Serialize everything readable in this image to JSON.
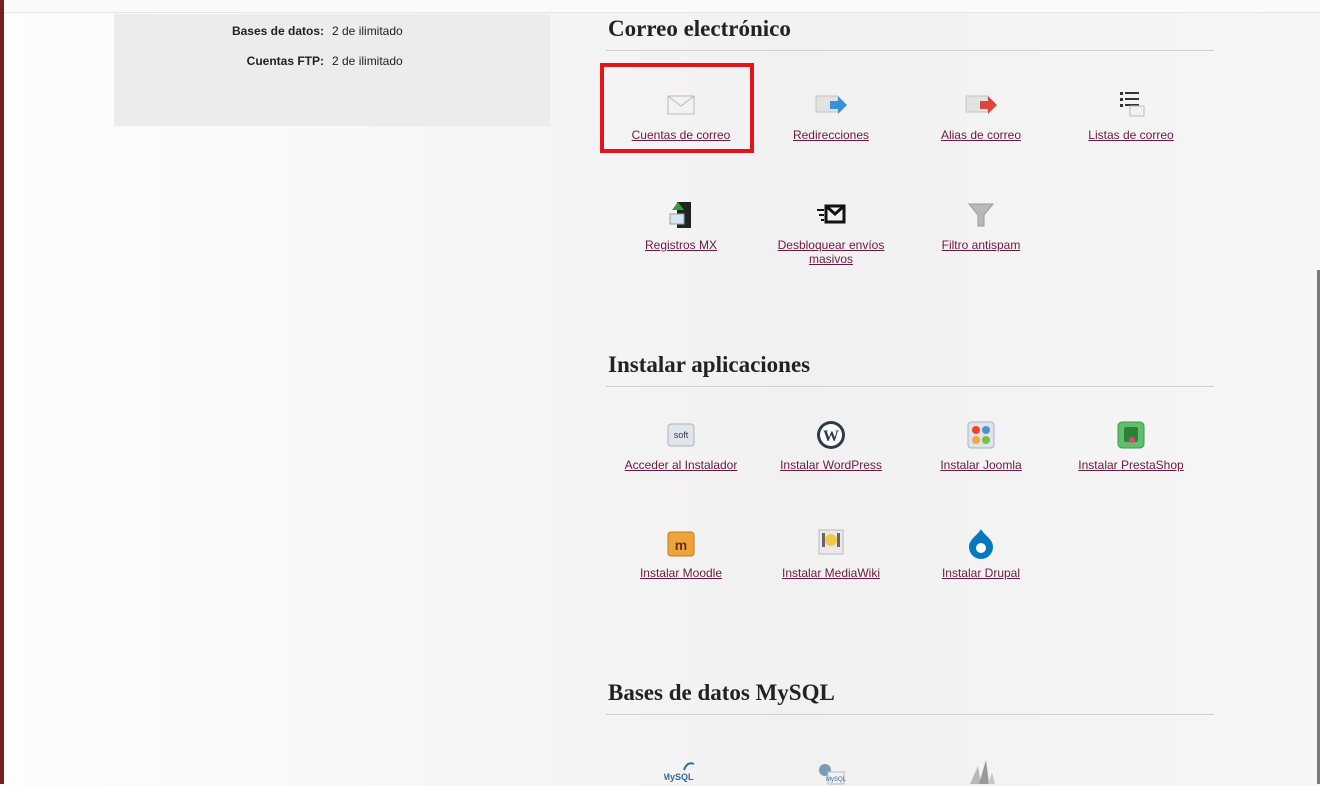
{
  "limits": [
    {
      "label": "Bases de datos:",
      "value": "2 de ilimitado"
    },
    {
      "label": "Cuentas FTP:",
      "value": "2 de ilimitado"
    }
  ],
  "email": {
    "title": "Correo electrónico",
    "items": [
      {
        "label": "Cuentas de correo",
        "icon": "envelope-icon"
      },
      {
        "label": "Redirecciones",
        "icon": "forward-arrow-icon"
      },
      {
        "label": "Alias de correo",
        "icon": "alias-arrow-icon"
      },
      {
        "label": "Listas de correo",
        "icon": "list-icon"
      },
      {
        "label": "Registros MX",
        "icon": "mx-server-icon"
      },
      {
        "label": "Desbloquear envíos masivos",
        "icon": "mass-mail-icon"
      },
      {
        "label": "Filtro antispam",
        "icon": "funnel-icon"
      }
    ]
  },
  "apps": {
    "title": "Instalar aplicaciones",
    "items": [
      {
        "label": "Acceder al Instalador",
        "icon": "softaculous-icon"
      },
      {
        "label": "Instalar WordPress",
        "icon": "wordpress-icon"
      },
      {
        "label": "Instalar Joomla",
        "icon": "joomla-icon"
      },
      {
        "label": "Instalar PrestaShop",
        "icon": "prestashop-icon"
      },
      {
        "label": "Instalar Moodle",
        "icon": "moodle-icon"
      },
      {
        "label": "Instalar MediaWiki",
        "icon": "mediawiki-icon"
      },
      {
        "label": "Instalar Drupal",
        "icon": "drupal-icon"
      }
    ]
  },
  "mysql": {
    "title": "Bases de datos MySQL",
    "items": [
      {
        "icon": "mysql-icon"
      },
      {
        "icon": "mysql-users-icon"
      },
      {
        "icon": "phpmyadmin-icon"
      }
    ]
  },
  "colors": {
    "link": "#6b1a3f",
    "highlight": "#e4141a"
  }
}
